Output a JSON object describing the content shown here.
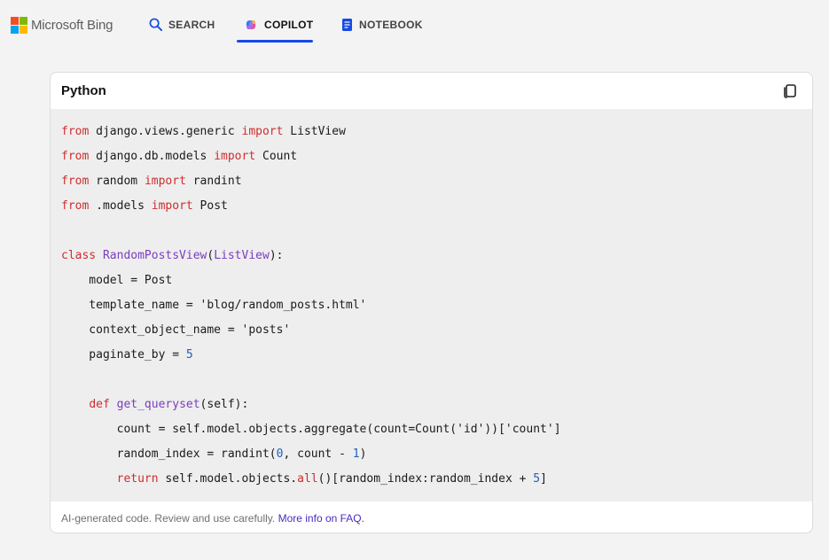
{
  "header": {
    "brand": "Microsoft Bing",
    "nav": [
      {
        "label": "SEARCH",
        "icon": "search-icon"
      },
      {
        "label": "COPILOT",
        "icon": "copilot-icon",
        "active": true
      },
      {
        "label": "NOTEBOOK",
        "icon": "notebook-icon"
      }
    ]
  },
  "code_block": {
    "language": "Python",
    "copy_icon": "copy-icon",
    "lines": [
      [
        {
          "t": "from",
          "c": "kw"
        },
        {
          "t": " django.views.generic "
        },
        {
          "t": "import",
          "c": "kw"
        },
        {
          "t": " ListView"
        }
      ],
      [
        {
          "t": "from",
          "c": "kw"
        },
        {
          "t": " django.db.models "
        },
        {
          "t": "import",
          "c": "kw"
        },
        {
          "t": " Count"
        }
      ],
      [
        {
          "t": "from",
          "c": "kw"
        },
        {
          "t": " random "
        },
        {
          "t": "import",
          "c": "kw"
        },
        {
          "t": " randint"
        }
      ],
      [
        {
          "t": "from",
          "c": "kw"
        },
        {
          "t": " .models "
        },
        {
          "t": "import",
          "c": "kw"
        },
        {
          "t": " Post"
        }
      ],
      [],
      [
        {
          "t": "class",
          "c": "kw"
        },
        {
          "t": " "
        },
        {
          "t": "RandomPostsView",
          "c": "cls"
        },
        {
          "t": "("
        },
        {
          "t": "ListView",
          "c": "cls"
        },
        {
          "t": "):"
        }
      ],
      [
        {
          "t": "    model = Post"
        }
      ],
      [
        {
          "t": "    template_name = 'blog/random_posts.html'"
        }
      ],
      [
        {
          "t": "    context_object_name = 'posts'"
        }
      ],
      [
        {
          "t": "    paginate_by = "
        },
        {
          "t": "5",
          "c": "num"
        }
      ],
      [],
      [
        {
          "t": "    "
        },
        {
          "t": "def",
          "c": "kw"
        },
        {
          "t": " "
        },
        {
          "t": "get_queryset",
          "c": "fn"
        },
        {
          "t": "(self):"
        }
      ],
      [
        {
          "t": "        count = self.model.objects.aggregate(count=Count('id'))['count']"
        }
      ],
      [
        {
          "t": "        random_index = randint("
        },
        {
          "t": "0",
          "c": "num"
        },
        {
          "t": ", count - "
        },
        {
          "t": "1",
          "c": "num"
        },
        {
          "t": ")"
        }
      ],
      [
        {
          "t": "        "
        },
        {
          "t": "return",
          "c": "kw"
        },
        {
          "t": " self.model.objects."
        },
        {
          "t": "all",
          "c": "kw"
        },
        {
          "t": "()[random_index:random_index + "
        },
        {
          "t": "5",
          "c": "num"
        },
        {
          "t": "]"
        }
      ]
    ],
    "footer_text": "AI-generated code. Review and use carefully. ",
    "footer_link": "More info on FAQ."
  },
  "colors": {
    "keyword": "#cf2d2d",
    "class": "#7a3ec0",
    "number": "#2060c0",
    "accent": "#174ae4"
  }
}
